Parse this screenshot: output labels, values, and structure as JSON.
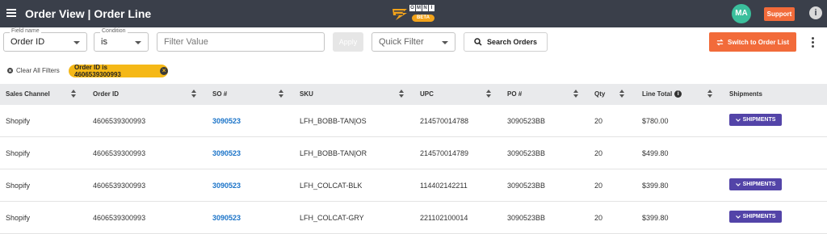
{
  "header": {
    "title": "Order View | Order Line",
    "logo_letters": [
      "O",
      "M",
      "N",
      "I"
    ],
    "logo_badge": "BETA",
    "avatar_initials": "MA",
    "support_label": "Support",
    "info_glyph": "i"
  },
  "filters": {
    "field_name_label": "Field name",
    "field_name_value": "Order ID",
    "condition_label": "Condition",
    "condition_value": "is",
    "filter_value_placeholder": "Filter Value",
    "apply_label": "Apply",
    "quick_filter_value": "Quick Filter",
    "search_label": "Search Orders",
    "switch_label": "Switch to Order List",
    "clear_all_label": "Clear All Filters",
    "active_chip": "Order ID is 4606539300993"
  },
  "colors": {
    "topbar": "#3a3f4a",
    "accent_orange": "#f26b3a",
    "chip_yellow": "#f5b817",
    "shipments_purple": "#5344a8",
    "link_blue": "#1a73c8"
  },
  "table": {
    "headers": {
      "sales_channel": "Sales Channel",
      "order_id": "Order ID",
      "so": "SO #",
      "sku": "SKU",
      "upc": "UPC",
      "po": "PO #",
      "qty": "Qty",
      "line_total": "Line Total",
      "shipments": "Shipments"
    },
    "shipments_button": "SHIPMENTS",
    "rows": [
      {
        "channel": "Shopify",
        "order_id": "4606539300993",
        "so": "3090523",
        "sku": "LFH_BOBB-TAN|OS",
        "upc": "214570014788",
        "po": "3090523BB",
        "qty": "20",
        "total": "$780.00",
        "has_shipments": true
      },
      {
        "channel": "Shopify",
        "order_id": "4606539300993",
        "so": "3090523",
        "sku": "LFH_BOBB-TAN|OR",
        "upc": "214570014789",
        "po": "3090523BB",
        "qty": "20",
        "total": "$499.80",
        "has_shipments": false
      },
      {
        "channel": "Shopify",
        "order_id": "4606539300993",
        "so": "3090523",
        "sku": "LFH_COLCAT-BLK",
        "upc": "114402142211",
        "po": "3090523BB",
        "qty": "20",
        "total": "$399.80",
        "has_shipments": true
      },
      {
        "channel": "Shopify",
        "order_id": "4606539300993",
        "so": "3090523",
        "sku": "LFH_COLCAT-GRY",
        "upc": "221102100014",
        "po": "3090523BB",
        "qty": "20",
        "total": "$399.80",
        "has_shipments": true
      }
    ]
  }
}
